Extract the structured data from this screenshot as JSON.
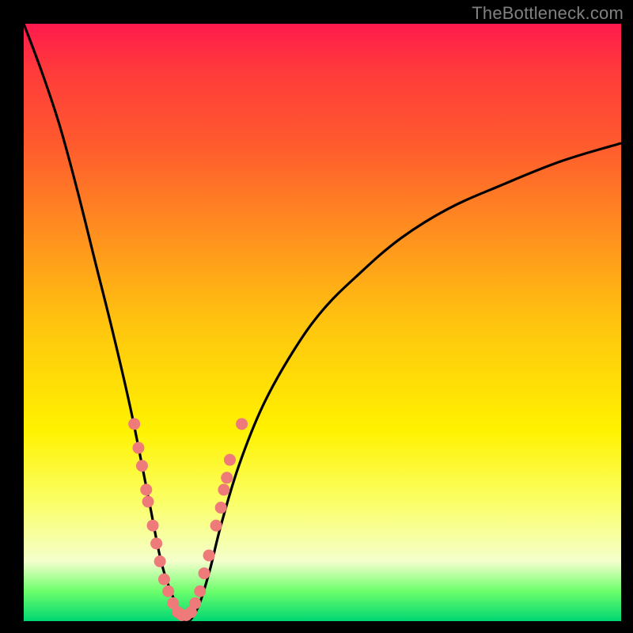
{
  "watermark": "TheBottleneck.com",
  "colors": {
    "background_frame": "#000000",
    "curve": "#000000",
    "point_fill": "#ee7a7a",
    "point_stroke": "#d85a5a",
    "gradient_top": "#ff1a4d",
    "gradient_bottom": "#00d672"
  },
  "chart_data": {
    "type": "line",
    "title": "",
    "xlabel": "",
    "ylabel": "",
    "xlim": [
      0,
      100
    ],
    "ylim": [
      0,
      100
    ],
    "note": "V-shaped bottleneck curve; y≈100 at x≈0, minimum y≈0 around x≈25–29, rising asymptotically toward y≈80–85 by x=100. Points are scattered along the lower portion of the curve.",
    "series": [
      {
        "name": "bottleneck-curve",
        "x": [
          0,
          3,
          6,
          9,
          12,
          15,
          18,
          21,
          23,
          25,
          27,
          29,
          31,
          33,
          36,
          40,
          45,
          50,
          56,
          63,
          71,
          80,
          90,
          100
        ],
        "y": [
          100,
          92,
          83,
          72,
          60,
          48,
          35,
          20,
          10,
          4,
          0,
          2,
          8,
          16,
          26,
          36,
          45,
          52,
          58,
          64,
          69,
          73,
          77,
          80
        ]
      }
    ],
    "points": [
      {
        "x": 18.5,
        "y": 33
      },
      {
        "x": 19.2,
        "y": 29
      },
      {
        "x": 19.8,
        "y": 26
      },
      {
        "x": 20.5,
        "y": 22
      },
      {
        "x": 20.8,
        "y": 20
      },
      {
        "x": 21.6,
        "y": 16
      },
      {
        "x": 22.2,
        "y": 13
      },
      {
        "x": 22.8,
        "y": 10
      },
      {
        "x": 23.5,
        "y": 7
      },
      {
        "x": 24.2,
        "y": 5
      },
      {
        "x": 25.0,
        "y": 3
      },
      {
        "x": 25.8,
        "y": 1.5
      },
      {
        "x": 26.5,
        "y": 1
      },
      {
        "x": 27.2,
        "y": 1
      },
      {
        "x": 28.0,
        "y": 1.5
      },
      {
        "x": 28.7,
        "y": 3
      },
      {
        "x": 29.5,
        "y": 5
      },
      {
        "x": 30.2,
        "y": 8
      },
      {
        "x": 31.0,
        "y": 11
      },
      {
        "x": 32.2,
        "y": 16
      },
      {
        "x": 33.0,
        "y": 19
      },
      {
        "x": 33.5,
        "y": 22
      },
      {
        "x": 34.0,
        "y": 24
      },
      {
        "x": 34.5,
        "y": 27
      },
      {
        "x": 36.5,
        "y": 33
      }
    ]
  }
}
